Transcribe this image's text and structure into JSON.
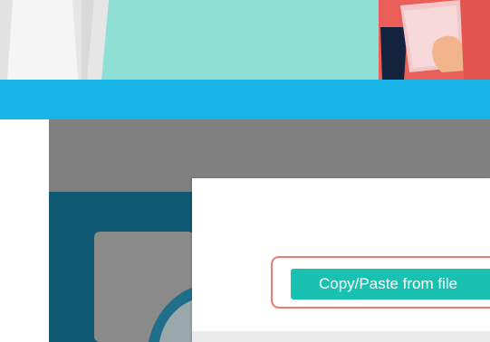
{
  "colors": {
    "hero_bg": "#8fdfd4",
    "banner_bg": "#19b4e8",
    "overlay": "#808080",
    "button_bg": "#19c2b0",
    "highlight_border": "#ef7a6e"
  },
  "modal": {
    "copy_paste_label": "Copy/Paste from file"
  }
}
